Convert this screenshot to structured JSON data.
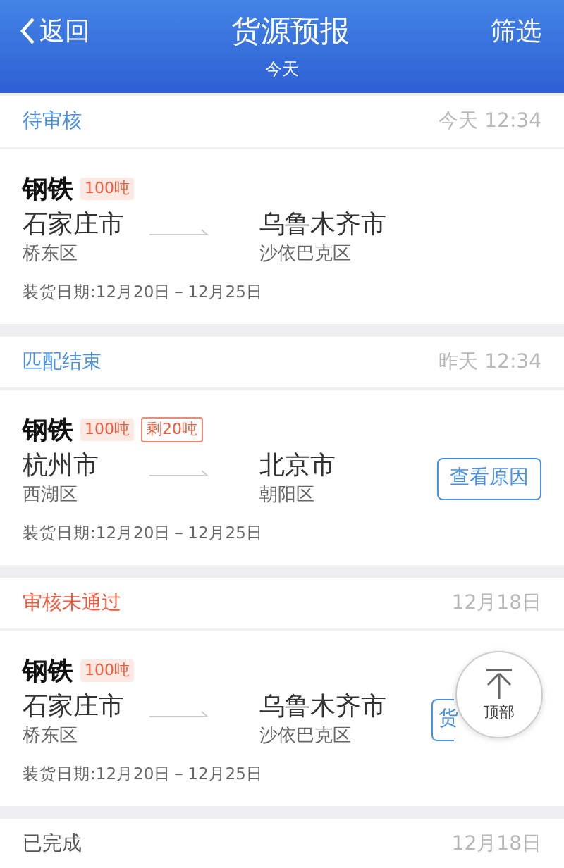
{
  "header": {
    "back": "返回",
    "title": "货源预报",
    "subtitle": "今天",
    "filter": "筛选"
  },
  "sections": [
    {
      "status": "待审核",
      "color": "#4a90e2",
      "time": "今天 12:34",
      "card": {
        "cargo": "钢铁",
        "tags": [
          {
            "kind": "filled",
            "text": "100吨"
          }
        ],
        "from": {
          "city": "石家庄市",
          "district": "桥东区"
        },
        "to": {
          "city": "乌鲁木齐市",
          "district": "沙依巴克区"
        },
        "dates": "装货日期:12月20日－12月25日"
      }
    },
    {
      "status": "匹配结束",
      "color": "#4a90e2",
      "time": "昨天 12:34",
      "card": {
        "cargo": "钢铁",
        "tags": [
          {
            "kind": "filled",
            "text": "100吨"
          },
          {
            "kind": "outlined",
            "text": "剩20吨"
          }
        ],
        "from": {
          "city": "杭州市",
          "district": "西湖区"
        },
        "to": {
          "city": "北京市",
          "district": "朝阳区"
        },
        "dates": "装货日期:12月20日－12月25日",
        "button": {
          "label": "查看原因",
          "cut": false
        }
      }
    },
    {
      "status": "审核未通过",
      "color": "#ef5a3c",
      "time": "12月18日",
      "card": {
        "cargo": "钢铁",
        "tags": [
          {
            "kind": "filled",
            "text": "100吨"
          }
        ],
        "from": {
          "city": "石家庄市",
          "district": "桥东区"
        },
        "to": {
          "city": "乌鲁木齐市",
          "district": "沙依巴克区"
        },
        "dates": "装货日期:12月20日－12月25日",
        "button": {
          "label": "货",
          "cut": true
        }
      }
    },
    {
      "status": "已完成",
      "color": "#555555",
      "time": "12月18日"
    }
  ],
  "top_button": {
    "label": "顶部"
  }
}
